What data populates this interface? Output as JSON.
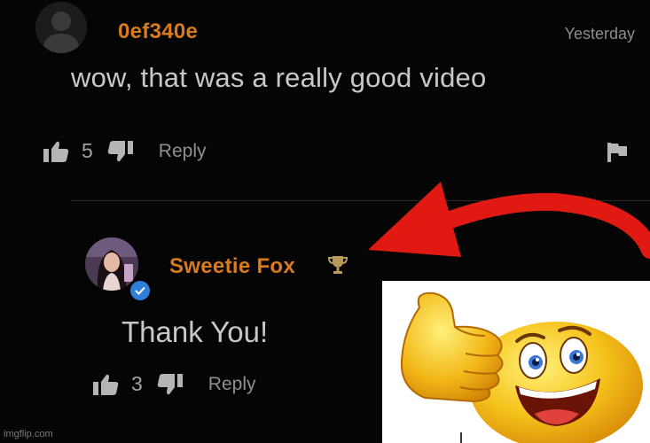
{
  "comment": {
    "username": "0ef340e",
    "timestamp": "Yesterday",
    "text": "wow, that was a really good video",
    "likes": "5",
    "reply_label": "Reply"
  },
  "reply": {
    "username": "Sweetie Fox",
    "text": "Thank You!",
    "likes": "3",
    "reply_label": "Reply"
  },
  "watermark": "imgflip.com",
  "colors": {
    "background": "#050505",
    "username": "#d97a1c",
    "text": "#c8c8c8",
    "arrow": "#e01a12",
    "verified": "#2f7fd8",
    "emoji": "#f5c21b"
  },
  "icons": [
    "user-avatar-icon",
    "thumbs-up-icon",
    "thumbs-down-icon",
    "flag-icon",
    "verified-badge-icon",
    "trophy-icon",
    "red-arrow",
    "thumbs-up-emoji"
  ]
}
